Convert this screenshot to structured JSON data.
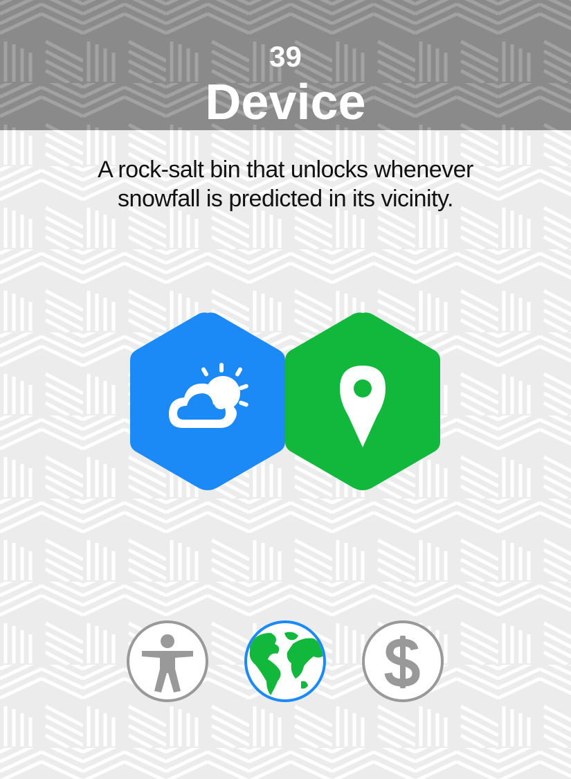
{
  "card": {
    "number": "39",
    "category": "Device",
    "description": "A rock-salt bin that unlocks whenever snowfall is predicted in its vicinity."
  },
  "components": [
    {
      "icon": "weather-icon",
      "color": "#1b8af7"
    },
    {
      "icon": "location-pin-icon",
      "color": "#12b83c"
    }
  ],
  "categories": [
    {
      "icon": "accessibility-person-icon",
      "selected": false,
      "color": "#999999"
    },
    {
      "icon": "globe-icon",
      "selected": true,
      "color": "#1b8af7",
      "fill": "#12b83c"
    },
    {
      "icon": "dollar-icon",
      "selected": false,
      "color": "#999999"
    }
  ],
  "colors": {
    "header": "#8e8e8e",
    "background": "#f2f2f2",
    "pattern_stripe": "#ffffff",
    "text": "#111111"
  }
}
